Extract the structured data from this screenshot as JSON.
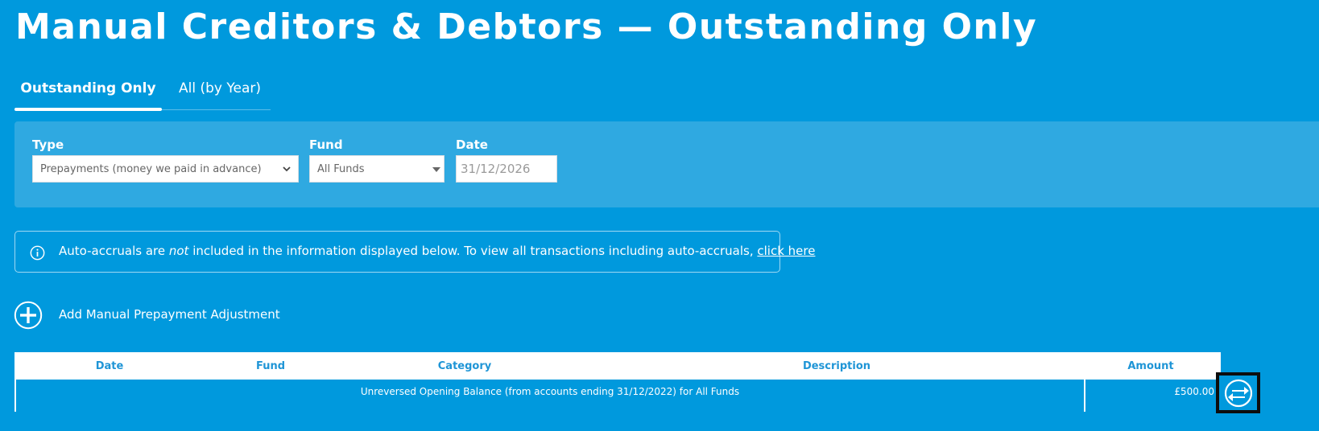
{
  "page": {
    "title": "Manual Creditors & Debtors — Outstanding Only"
  },
  "tabs": [
    {
      "label": "Outstanding Only",
      "active": true
    },
    {
      "label": "All (by Year)",
      "active": false
    }
  ],
  "filters": {
    "type": {
      "label": "Type",
      "value": "Prepayments (money we paid in advance)"
    },
    "fund": {
      "label": "Fund",
      "value": "All Funds"
    },
    "date": {
      "label": "Date",
      "value": "31/12/2026"
    }
  },
  "info": {
    "text_before": "Auto-accruals are ",
    "text_em": "not",
    "text_after": " included in the information displayed below. To view all transactions including auto-accruals, ",
    "link": "click here",
    "icon": "info-icon"
  },
  "add_adjustment": {
    "label": "Add Manual Prepayment Adjustment",
    "icon": "plus-circle-icon"
  },
  "table": {
    "columns": [
      "Date",
      "Fund",
      "Category",
      "Description",
      "Amount"
    ],
    "rows": [
      {
        "description": "Unreversed Opening Balance (from accounts ending 31/12/2022) for All Funds",
        "amount": "£500.00"
      }
    ]
  },
  "corner_button": {
    "icon": "swap-arrows-icon"
  },
  "colors": {
    "background": "#0099dd",
    "panel": "#2fa9e1",
    "header_text": "#1f95d6"
  }
}
